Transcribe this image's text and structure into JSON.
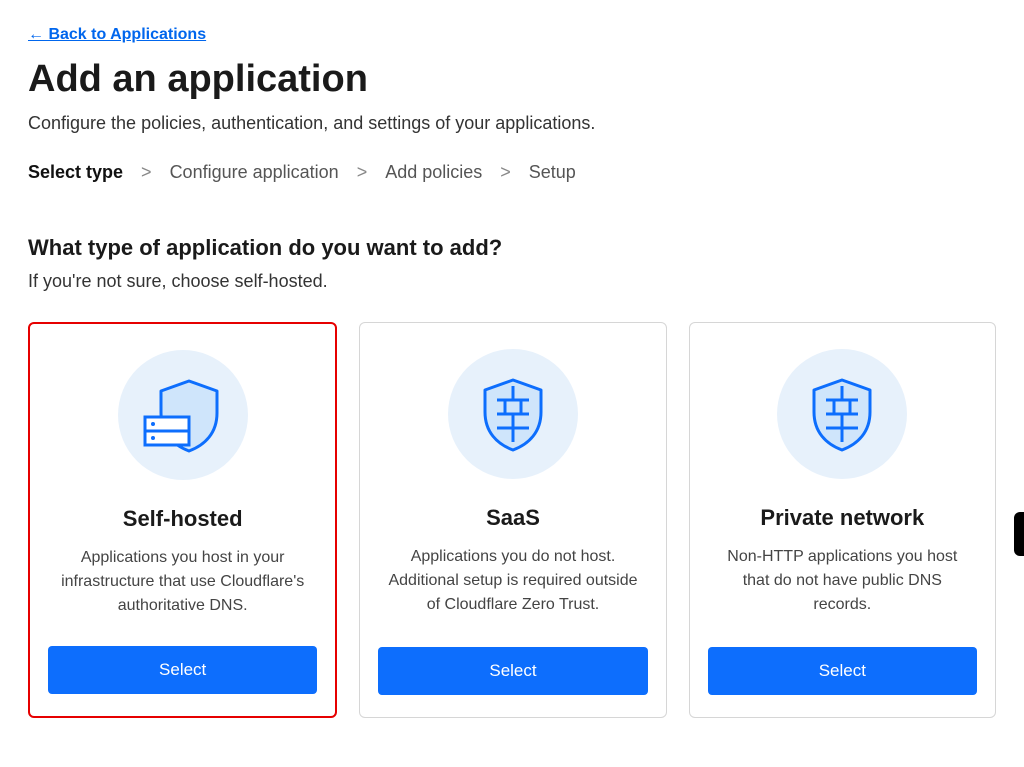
{
  "nav": {
    "back_label": "← Back to Applications"
  },
  "header": {
    "title": "Add an application",
    "subtitle": "Configure the policies, authentication, and settings of your applications."
  },
  "breadcrumb": {
    "steps": [
      {
        "label": "Select type",
        "active": true
      },
      {
        "label": "Configure application",
        "active": false
      },
      {
        "label": "Add policies",
        "active": false
      },
      {
        "label": "Setup",
        "active": false
      }
    ],
    "separator": ">"
  },
  "section": {
    "title": "What type of application do you want to add?",
    "hint": "If you're not sure, choose self-hosted."
  },
  "cards": [
    {
      "id": "self-hosted",
      "title": "Self-hosted",
      "description": "Applications you host in your infrastructure that use Cloudflare's authoritative DNS.",
      "button": "Select",
      "highlighted": true,
      "icon": "shield-server"
    },
    {
      "id": "saas",
      "title": "SaaS",
      "description": "Applications you do not host. Additional setup is required outside of Cloudflare Zero Trust.",
      "button": "Select",
      "highlighted": false,
      "icon": "shield-wall"
    },
    {
      "id": "private-network",
      "title": "Private network",
      "description": "Non-HTTP applications you host that do not have public DNS records.",
      "button": "Select",
      "highlighted": false,
      "icon": "shield-wall"
    }
  ]
}
